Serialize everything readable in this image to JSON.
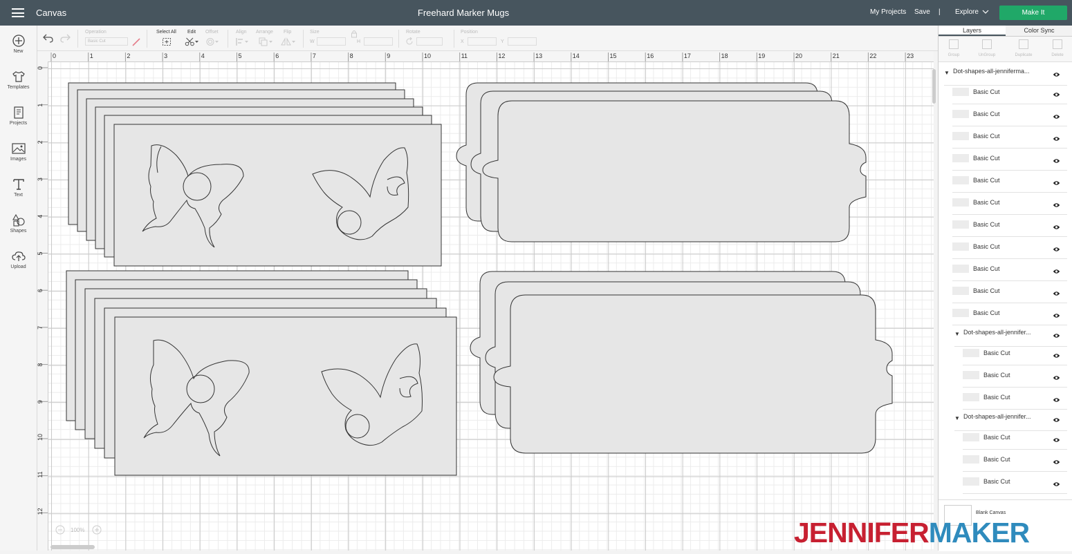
{
  "header": {
    "app_title": "Canvas",
    "document_title": "Freehard Marker Mugs",
    "my_projects": "My Projects",
    "save": "Save",
    "divider": "|",
    "explore": "Explore",
    "make_it": "Make It"
  },
  "sidebar": {
    "items": [
      {
        "label": "New",
        "icon": "plus-circle-icon"
      },
      {
        "label": "Templates",
        "icon": "tshirt-icon"
      },
      {
        "label": "Projects",
        "icon": "notebook-icon"
      },
      {
        "label": "Images",
        "icon": "image-icon"
      },
      {
        "label": "Text",
        "icon": "text-t-icon"
      },
      {
        "label": "Shapes",
        "icon": "shapes-icon"
      },
      {
        "label": "Upload",
        "icon": "cloud-upload-icon"
      }
    ]
  },
  "toolbar": {
    "operation_label": "Operation",
    "operation_value": "Basic Cut",
    "select_all": "Select All",
    "edit": "Edit",
    "offset": "Offset",
    "align": "Align",
    "arrange": "Arrange",
    "flip": "Flip",
    "size": "Size",
    "size_w": "W",
    "size_h": "H",
    "rotate": "Rotate",
    "position": "Position",
    "pos_x": "X",
    "pos_y": "Y"
  },
  "rulers": {
    "top": [
      "0",
      "1",
      "2",
      "3",
      "4",
      "5",
      "6",
      "7",
      "8",
      "9",
      "10",
      "11",
      "12",
      "13",
      "14",
      "15",
      "16",
      "17",
      "18",
      "19",
      "20",
      "21",
      "22",
      "23"
    ],
    "left": [
      "0",
      "1",
      "2",
      "3",
      "4",
      "5",
      "6",
      "7",
      "8",
      "9",
      "10",
      "11",
      "12"
    ]
  },
  "zoom": "100%",
  "panel": {
    "tabs": [
      "Layers",
      "Color Sync"
    ],
    "tools": [
      "Group",
      "UnGroup",
      "Duplicate",
      "Delete"
    ],
    "groups": [
      {
        "name": "Dot-shapes-all-jenniferma...",
        "layers": [
          "Basic Cut",
          "Basic Cut",
          "Basic Cut",
          "Basic Cut",
          "Basic Cut",
          "Basic Cut",
          "Basic Cut",
          "Basic Cut",
          "Basic Cut",
          "Basic Cut",
          "Basic Cut"
        ]
      },
      {
        "name": "Dot-shapes-all-jennifer...",
        "layers": [
          "Basic Cut",
          "Basic Cut",
          "Basic Cut"
        ]
      },
      {
        "name": "Dot-shapes-all-jennifer...",
        "layers": [
          "Basic Cut",
          "Basic Cut",
          "Basic Cut"
        ]
      }
    ],
    "blank_canvas": "Blank Canvas"
  },
  "watermark": {
    "part1": "JENNIFER",
    "part2": "MAKER"
  },
  "colors": {
    "header_bg": "#47555e",
    "make_it_green": "#20a868",
    "shape_fill": "#e6e6e6",
    "watermark_red": "#c72031",
    "watermark_blue": "#2f8bbd"
  }
}
